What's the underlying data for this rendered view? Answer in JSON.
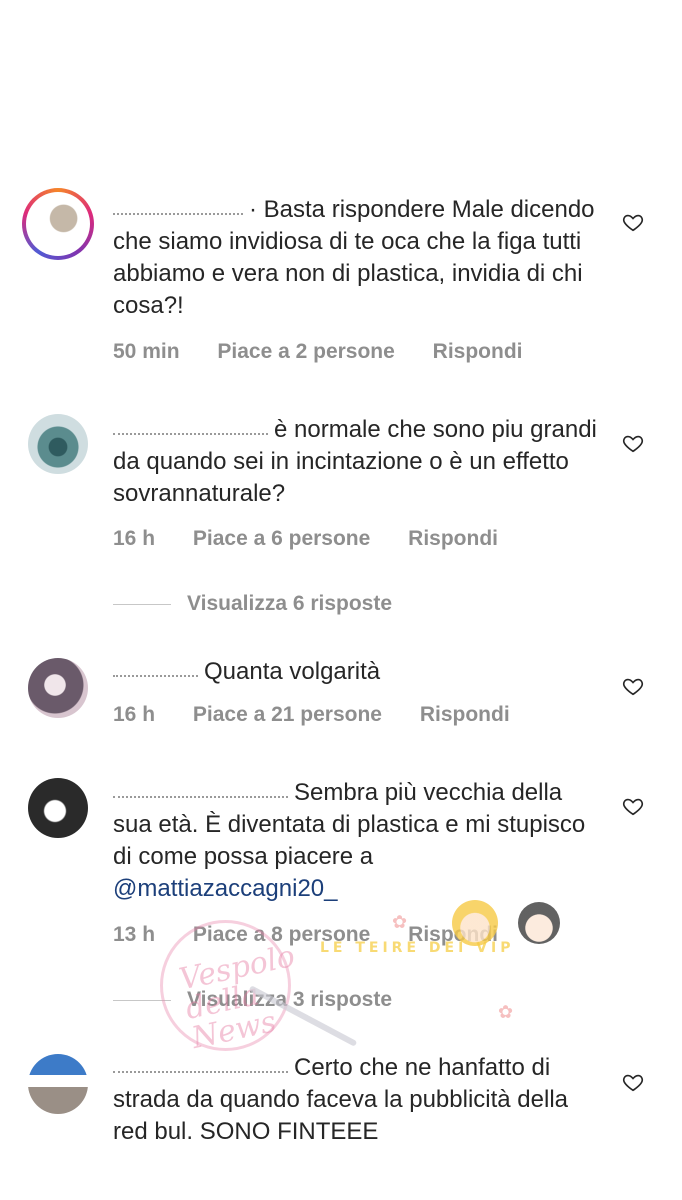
{
  "comments": [
    {
      "text": "· Basta rispondere Male dicendo che siamo invidiosa di te oca che la figa tutti abbiamo e vera non di plastica, invidia di chi cosa?!",
      "time": "50 min",
      "likes": "Piace a 2 persone",
      "reply": "Rispondi"
    },
    {
      "text": "è normale che sono piu grandi da quando sei in incintazione o è un effetto sovrannaturale?",
      "time": "16 h",
      "likes": "Piace a 6 persone",
      "reply": "Rispondi",
      "view_replies": "Visualizza 6 risposte"
    },
    {
      "text": "Quanta volgarità",
      "time": "16 h",
      "likes": "Piace a 21 persone",
      "reply": "Rispondi"
    },
    {
      "text": "Sembra più vecchia della sua età. È diventata di plastica e mi stupisco di come possa piacere a",
      "mention": "@mattiazaccagni20_",
      "time": "13 h",
      "likes": "Piace a 8 persone",
      "reply": "Rispondi",
      "view_replies": "Visualizza 3 risposte"
    },
    {
      "text": "Certo che ne hanfatto di strada da quando faceva la pubblicità della red bul. SONO FINTEEE"
    }
  ],
  "watermarks": {
    "left": "Vespolo della News",
    "right": "LE TEIRE DEI VIP"
  },
  "icons": {
    "like": "heart-outline-icon"
  },
  "colors": {
    "text": "#262626",
    "meta": "#8e8e8e",
    "mention": "#1c3f7a",
    "divider": "#c7c7c7"
  }
}
